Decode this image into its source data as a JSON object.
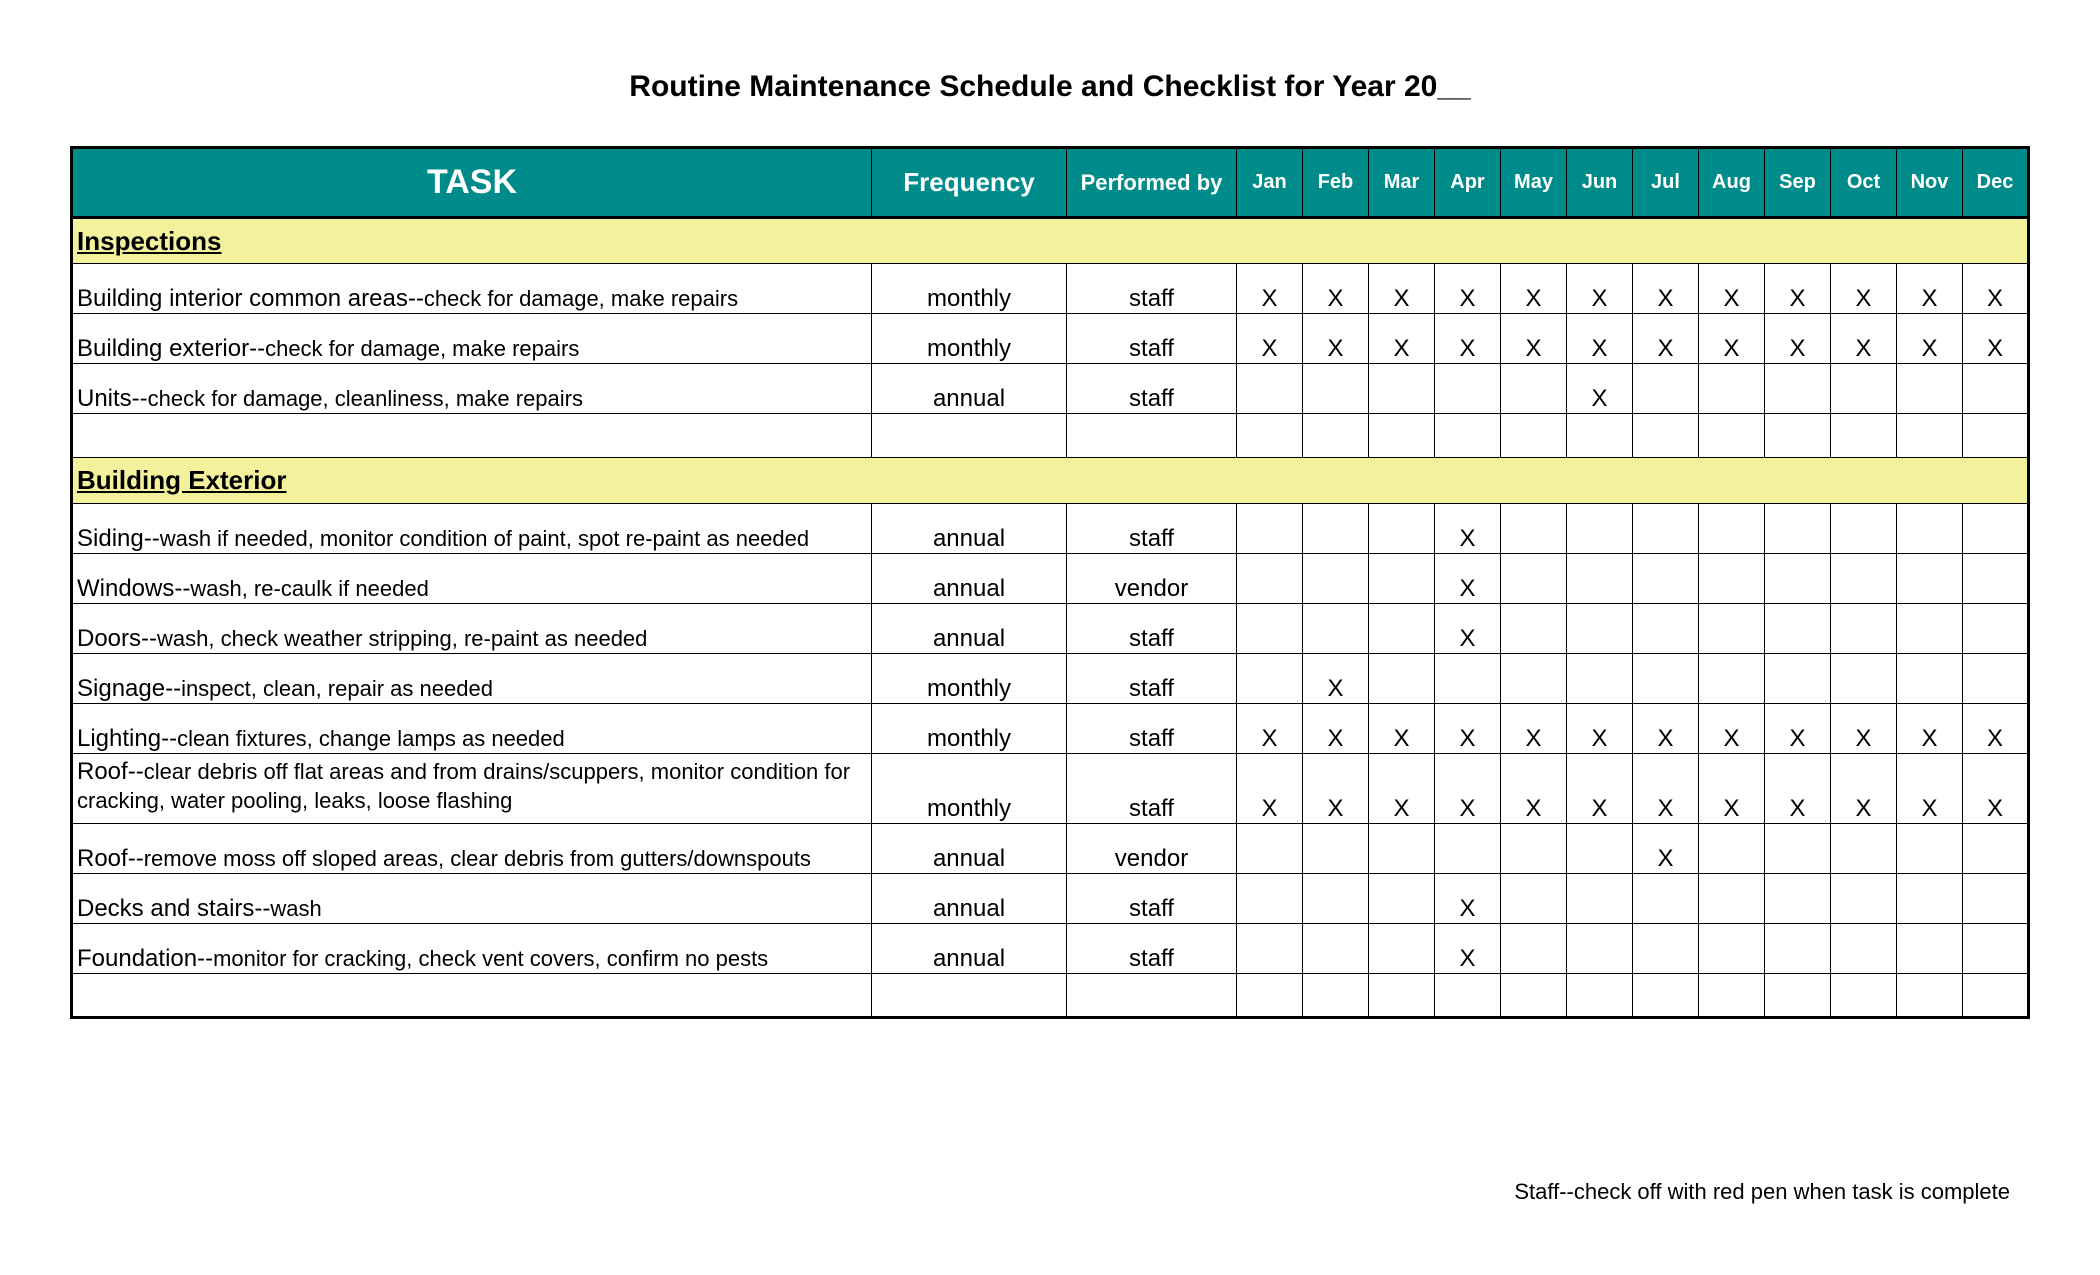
{
  "title": "Routine Maintenance Schedule and Checklist for Year 20__",
  "columns": {
    "task": "TASK",
    "frequency": "Frequency",
    "performed_by": "Performed by",
    "months": [
      "Jan",
      "Feb",
      "Mar",
      "Apr",
      "May",
      "Jun",
      "Jul",
      "Aug",
      "Sep",
      "Oct",
      "Nov",
      "Dec"
    ]
  },
  "mark": "X",
  "sections": [
    {
      "heading": "Inspections",
      "rows": [
        {
          "lead": "Building interior common areas--",
          "detail": "check for damage, make repairs",
          "frequency": "monthly",
          "performed_by": "staff",
          "months": [
            true,
            true,
            true,
            true,
            true,
            true,
            true,
            true,
            true,
            true,
            true,
            true
          ]
        },
        {
          "lead": "Building exterior--",
          "detail": "check for damage, make repairs",
          "frequency": "monthly",
          "performed_by": "staff",
          "months": [
            true,
            true,
            true,
            true,
            true,
            true,
            true,
            true,
            true,
            true,
            true,
            true
          ]
        },
        {
          "lead": "Units--",
          "detail": "check for damage, cleanliness, make repairs",
          "frequency": "annual",
          "performed_by": "staff",
          "months": [
            false,
            false,
            false,
            false,
            false,
            true,
            false,
            false,
            false,
            false,
            false,
            false
          ]
        }
      ],
      "trailing_blank": true
    },
    {
      "heading": "Building Exterior",
      "rows": [
        {
          "lead": "Siding--",
          "detail": "wash if needed, monitor condition of paint, spot re-paint as needed",
          "frequency": "annual",
          "performed_by": "staff",
          "months": [
            false,
            false,
            false,
            true,
            false,
            false,
            false,
            false,
            false,
            false,
            false,
            false
          ]
        },
        {
          "lead": "Windows--",
          "detail": "wash, re-caulk if needed",
          "frequency": "annual",
          "performed_by": "vendor",
          "months": [
            false,
            false,
            false,
            true,
            false,
            false,
            false,
            false,
            false,
            false,
            false,
            false
          ]
        },
        {
          "lead": "Doors--",
          "detail": "wash, check weather stripping, re-paint as needed",
          "frequency": "annual",
          "performed_by": "staff",
          "months": [
            false,
            false,
            false,
            true,
            false,
            false,
            false,
            false,
            false,
            false,
            false,
            false
          ]
        },
        {
          "lead": "Signage--",
          "detail": "inspect, clean, repair as needed",
          "frequency": "monthly",
          "performed_by": "staff",
          "months": [
            false,
            true,
            false,
            false,
            false,
            false,
            false,
            false,
            false,
            false,
            false,
            false
          ]
        },
        {
          "lead": "Lighting--",
          "detail": "clean fixtures, change lamps as needed",
          "frequency": "monthly",
          "performed_by": "staff",
          "months": [
            true,
            true,
            true,
            true,
            true,
            true,
            true,
            true,
            true,
            true,
            true,
            true
          ]
        },
        {
          "lead": "Roof--",
          "detail": "clear debris off flat areas and from drains/scuppers, monitor condition for cracking, water pooling, leaks, loose flashing",
          "frequency": "monthly",
          "performed_by": "staff",
          "months": [
            true,
            true,
            true,
            true,
            true,
            true,
            true,
            true,
            true,
            true,
            true,
            true
          ],
          "tall": true
        },
        {
          "lead": "Roof--",
          "detail": "remove moss off sloped areas, clear debris from gutters/downspouts",
          "frequency": "annual",
          "performed_by": "vendor",
          "months": [
            false,
            false,
            false,
            false,
            false,
            false,
            true,
            false,
            false,
            false,
            false,
            false
          ]
        },
        {
          "lead": "Decks and stairs--",
          "detail": "wash",
          "frequency": "annual",
          "performed_by": "staff",
          "months": [
            false,
            false,
            false,
            true,
            false,
            false,
            false,
            false,
            false,
            false,
            false,
            false
          ]
        },
        {
          "lead": "Foundation--",
          "detail": "monitor for cracking, check vent covers, confirm no pests",
          "frequency": "annual",
          "performed_by": "staff",
          "months": [
            false,
            false,
            false,
            true,
            false,
            false,
            false,
            false,
            false,
            false,
            false,
            false
          ]
        }
      ],
      "trailing_blank": true
    }
  ],
  "footnote": "Staff--check off with red pen when task is complete",
  "colors": {
    "header_bg": "#008b8b",
    "section_bg": "#f3f19b"
  }
}
